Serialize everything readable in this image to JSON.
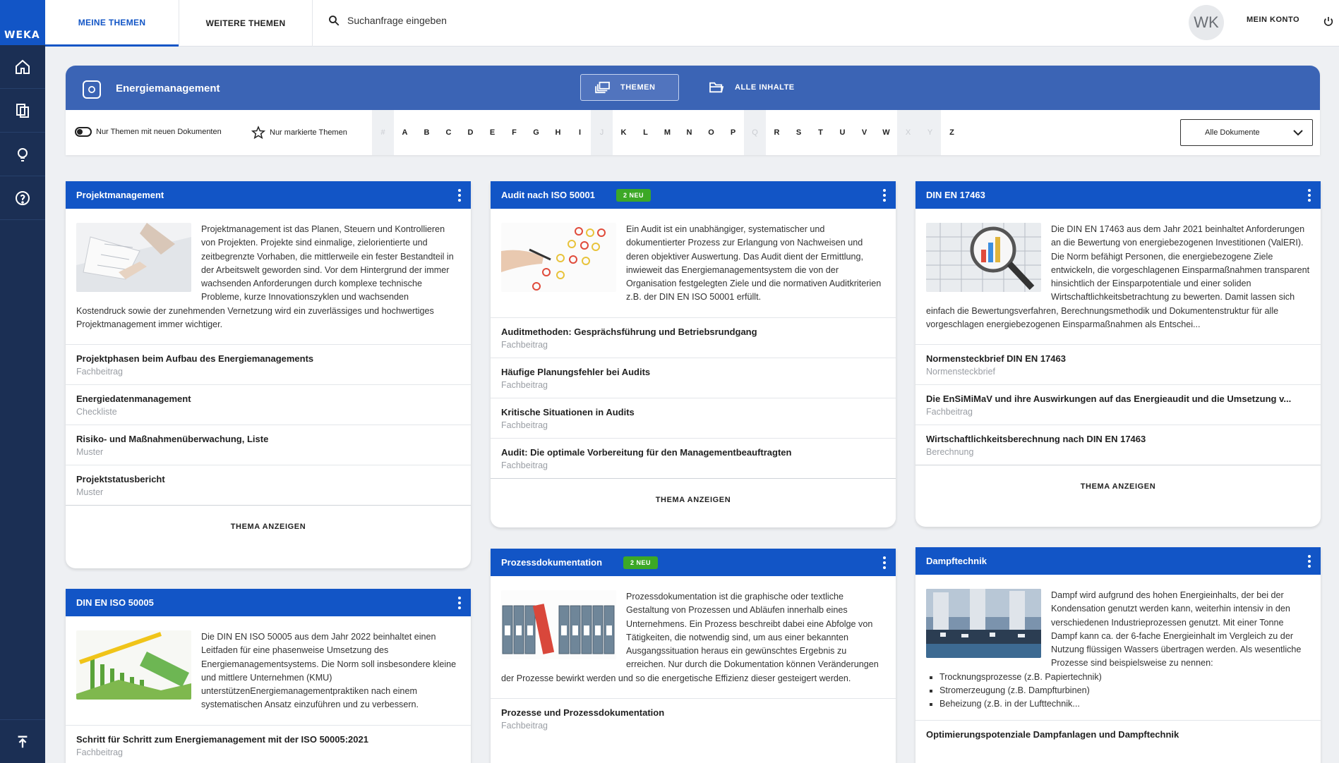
{
  "brand": {
    "logo": "WEKA",
    "accent": "#1255c6",
    "sidebar_bg": "#1b2f54",
    "badge_color": "#3ca826"
  },
  "sidebar": {
    "items": [
      {
        "name": "home-icon"
      },
      {
        "name": "documents-icon"
      },
      {
        "name": "lightbulb-icon"
      },
      {
        "name": "help-icon"
      }
    ],
    "bottom": {
      "name": "scroll-top-icon"
    }
  },
  "topbar": {
    "tabs": [
      {
        "label": "MEINE THEMEN",
        "active": true
      },
      {
        "label": "WEITERE THEMEN",
        "active": false
      }
    ],
    "search_placeholder": "Suchanfrage eingeben",
    "avatar_initials": "WK",
    "account_label": "MEIN KONTO"
  },
  "panel": {
    "title": "Energiemanagement",
    "segments": [
      {
        "label": "THEMEN",
        "active": true
      },
      {
        "label": "ALLE INHALTE",
        "active": false
      }
    ],
    "toggle_label": "Nur Themen mit neuen Dokumenten",
    "marked_label": "Nur markierte Themen",
    "letters": [
      {
        "c": "#",
        "enabled": false
      },
      {
        "c": "A",
        "enabled": true
      },
      {
        "c": "B",
        "enabled": true
      },
      {
        "c": "C",
        "enabled": true
      },
      {
        "c": "D",
        "enabled": true
      },
      {
        "c": "E",
        "enabled": true
      },
      {
        "c": "F",
        "enabled": true
      },
      {
        "c": "G",
        "enabled": true
      },
      {
        "c": "H",
        "enabled": true
      },
      {
        "c": "I",
        "enabled": true
      },
      {
        "c": "J",
        "enabled": false
      },
      {
        "c": "K",
        "enabled": true
      },
      {
        "c": "L",
        "enabled": true
      },
      {
        "c": "M",
        "enabled": true
      },
      {
        "c": "N",
        "enabled": true
      },
      {
        "c": "O",
        "enabled": true
      },
      {
        "c": "P",
        "enabled": true
      },
      {
        "c": "Q",
        "enabled": false
      },
      {
        "c": "R",
        "enabled": true
      },
      {
        "c": "S",
        "enabled": true
      },
      {
        "c": "T",
        "enabled": true
      },
      {
        "c": "U",
        "enabled": true
      },
      {
        "c": "V",
        "enabled": true
      },
      {
        "c": "W",
        "enabled": true
      },
      {
        "c": "X",
        "enabled": false
      },
      {
        "c": "Y",
        "enabled": false
      },
      {
        "c": "Z",
        "enabled": true
      }
    ],
    "dropdown_value": "Alle Dokumente"
  },
  "cards": {
    "projekt": {
      "title": "Projektmanagement",
      "text": "Projektmanagement ist das Planen, Steuern und Kontrollieren von Projekten. Projekte sind einmalige, zielorientierte und zeitbegrenzte Vorhaben, die mittlerweile ein fester Bestandteil in der Arbeitswelt geworden sind. Vor dem Hintergrund der immer wachsenden Anforderungen durch komplexe technische Probleme, kurze Innovationszyklen und wachsenden Kostendruck sowie der zunehmenden Vernetzung wird ein zuverlässiges und hochwertiges Projektmanagement immer wichtiger.",
      "docs": [
        {
          "title": "Projektphasen beim Aufbau des Energiemanagements",
          "type": "Fachbeitrag"
        },
        {
          "title": "Energiedatenmanagement",
          "type": "Checkliste"
        },
        {
          "title": "Risiko- und Maßnahmenüberwachung, Liste",
          "type": "Muster"
        },
        {
          "title": "Projektstatusbericht",
          "type": "Muster"
        }
      ],
      "footer": "THEMA ANZEIGEN"
    },
    "audit": {
      "title": "Audit nach ISO 50001",
      "badge": "2 NEU",
      "text": "Ein Audit ist ein unabhängiger, systematischer und dokumentierter Prozess zur Erlangung von Nachweisen und deren objektiver Auswertung. Das Audit dient der Ermittlung, inwieweit das Energiemanagementsystem die von der Organisation festgelegten Ziele und die normativen Auditkriterien z.B. der DIN EN ISO 50001 erfüllt.",
      "docs": [
        {
          "title": "Auditmethoden: Gesprächsführung und Betriebsrundgang",
          "type": "Fachbeitrag"
        },
        {
          "title": "Häufige Planungsfehler bei Audits",
          "type": "Fachbeitrag"
        },
        {
          "title": "Kritische Situationen in Audits",
          "type": "Fachbeitrag"
        },
        {
          "title": "Audit: Die optimale Vorbereitung für den Managementbeauftragten",
          "type": "Fachbeitrag"
        }
      ],
      "footer": "THEMA ANZEIGEN"
    },
    "din17463": {
      "title": "DIN EN 17463",
      "text": "Die DIN EN 17463 aus dem Jahr 2021 beinhaltet Anforderungen an die Bewertung von energiebezogenen Investitionen (ValERI). Die Norm befähigt Personen, die energiebezogene Ziele entwickeln, die vorgeschlagenen Einsparmaßnahmen transparent hinsichtlich der Einsparpotentiale und einer soliden Wirtschaftlichkeitsbetrachtung zu bewerten. Damit lassen sich einfach die Bewertungsverfahren, Berechnungsmethodik und Dokumentenstruktur für alle vorgeschlagen energiebezogenen Einsparmaßnahmen als Entschei...",
      "docs": [
        {
          "title": "Normensteckbrief DIN EN 17463",
          "type": "Normensteckbrief"
        },
        {
          "title": "Die EnSiMiMaV und ihre Auswirkungen auf das Energieaudit und die Umsetzung v...",
          "type": "Fachbeitrag"
        },
        {
          "title": "Wirtschaftlichkeitsberechnung nach DIN EN 17463",
          "type": "Berechnung"
        }
      ],
      "footer": "THEMA ANZEIGEN"
    },
    "iso50005": {
      "title": "DIN EN ISO 50005",
      "text": "Die DIN EN ISO 50005 aus dem Jahr 2022 beinhaltet einen Leitfaden für eine phasenweise Umsetzung des Energiemanagementsystems. Die Norm soll insbesondere kleine und mittlere Unternehmen (KMU) unterstützenEnergiemanagementpraktiken nach einem systematischen Ansatz einzuführen und zu verbessern.",
      "docs": [
        {
          "title": "Schritt für Schritt zum Energiemanagement mit der ISO 50005:2021",
          "type": "Fachbeitrag"
        }
      ]
    },
    "prozess": {
      "title": "Prozessdokumentation",
      "badge": "2 NEU",
      "text": "Prozessdokumentation ist die graphische oder textliche Gestaltung von Prozessen und Abläufen innerhalb eines Unternehmens. Ein Prozess beschreibt dabei eine Abfolge von Tätigkeiten, die notwendig sind, um aus einer bekannten Ausgangssituation heraus ein gewünschtes Ergebnis zu erreichen. Nur durch die Dokumentation können Veränderungen der Prozesse bewirkt werden und so die energetische Effizienz dieser gesteigert werden.",
      "docs": [
        {
          "title": "Prozesse und Prozessdokumentation",
          "type": "Fachbeitrag"
        }
      ]
    },
    "dampf": {
      "title": "Dampftechnik",
      "text": "Dampf wird aufgrund des hohen Energieinhalts, der bei der Kondensation genutzt werden kann, weiterhin intensiv in den verschiedenen Industrieprozessen genutzt. Mit einer Tonne Dampf kann ca. der 6-fache Energieinhalt im Vergleich zu der Nutzung flüssigen Wassers übertragen werden. Als wesentliche Prozesse sind beispielsweise zu nennen:",
      "bullets": [
        "Trocknungsprozesse (z.B. Papiertechnik)",
        "Stromerzeugung (z.B. Dampfturbinen)",
        "Beheizung (z.B. in der Lufttechnik..."
      ],
      "docs": [
        {
          "title": "Optimierungspotenziale Dampfanlagen und Dampftechnik",
          "type": ""
        }
      ]
    }
  }
}
